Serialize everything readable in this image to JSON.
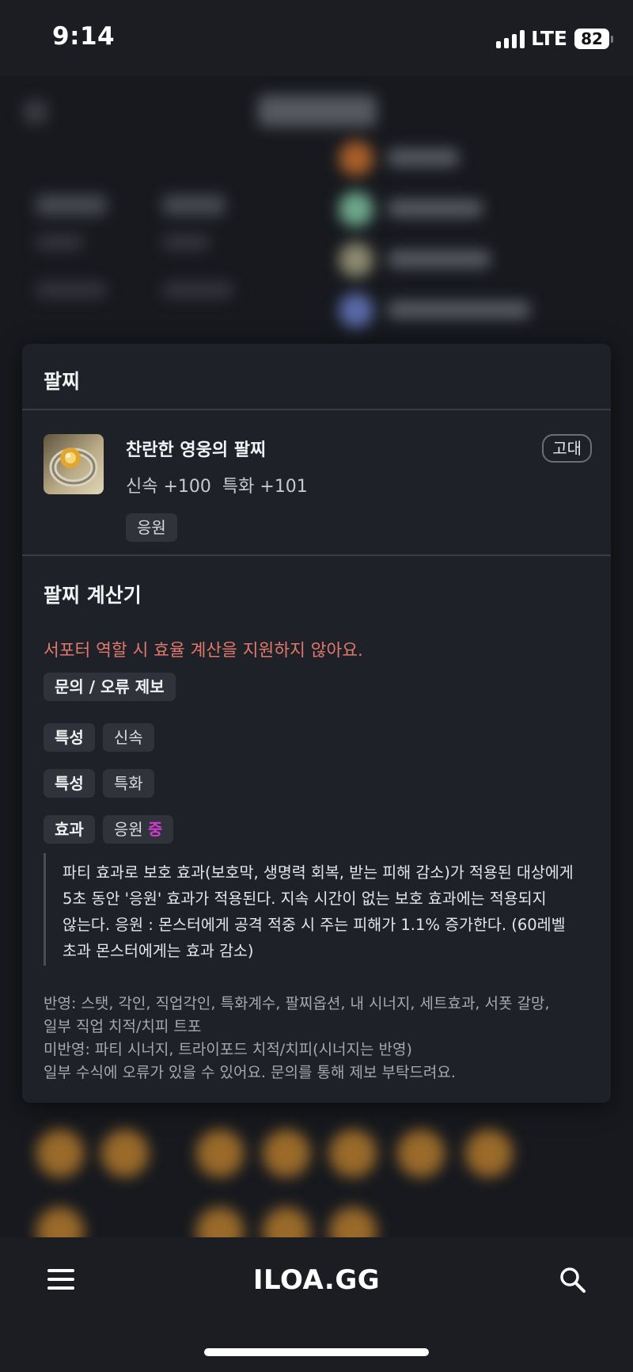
{
  "status_bar": {
    "time": "9:14",
    "network": "LTE",
    "battery": "82"
  },
  "modal": {
    "title": "팔찌",
    "item": {
      "name": "찬란한 영웅의 팔찌",
      "stats": [
        "신속 +100",
        "특화 +101"
      ],
      "tag": "응원",
      "grade": "고대"
    },
    "calculator": {
      "title": "팔찌 계산기",
      "warning": "서포터 역할 시 효율 계산을 지원하지 않아요.",
      "report_button": "문의 / 오류 제보",
      "rows": [
        {
          "label": "특성",
          "value": "신속"
        },
        {
          "label": "특성",
          "value": "특화"
        }
      ],
      "effect": {
        "label": "효과",
        "value": "응원",
        "level": "중"
      },
      "description_lines": [
        "파티 효과로 보호 효과(보호막, 생명력 회복, 받는 피해 감소)가 적용된 대상에게",
        "5초 동안 '응원' 효과가 적용된다. 지속 시간이 없는 보호 효과에는 적용되지",
        "않는다. 응원 : 몬스터에게 공격 적중 시 주는 피해가 1.1% 증가한다. (60레벨",
        "초과 몬스터에게는 효과 감소)"
      ],
      "notes": [
        "반영: 스탯, 각인, 직업각인, 특화계수, 팔찌옵션, 내 시너지, 세트효과, 서폿 갈망,",
        "일부 직업 치적/치피 트포",
        "미반영: 파티 시너지, 트라이포드 치적/치피(시너지는 반영)",
        "일부 수식에 오류가 있을 수 있어요. 문의를 통해 제보 부탁드려요."
      ]
    }
  },
  "bottom_nav": {
    "logo": "ILOA.GG",
    "menu_icon": "hamburger-menu-icon",
    "search_icon": "search-icon"
  },
  "colors": {
    "warning": "#e0786c",
    "level_mid": "#d23ccf",
    "modal_bg": "#1f2128"
  }
}
